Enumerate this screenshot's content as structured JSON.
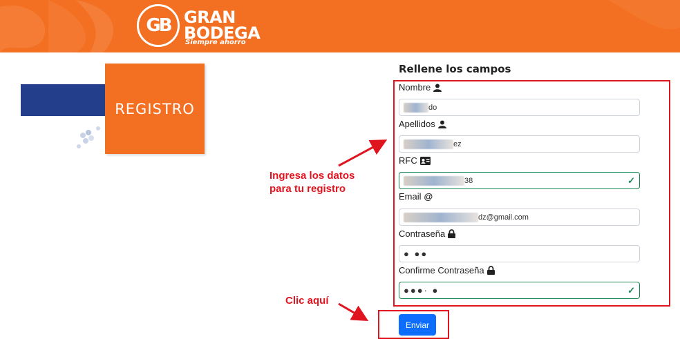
{
  "header": {
    "brand_line1": "GRAN",
    "brand_line2": "BODEGA",
    "tagline": "Siempre ahorro",
    "logo_mark": "GB"
  },
  "banner": {
    "title": "REGISTRO"
  },
  "form": {
    "title": "Rellene los campos",
    "fields": [
      {
        "label": "Nombre",
        "icon": "user-icon",
        "visible_value": "do",
        "valid": false
      },
      {
        "label": "Apellidos",
        "icon": "user-icon",
        "visible_value": "ez",
        "valid": false
      },
      {
        "label": "RFC",
        "icon": "id-card-icon",
        "visible_value": "38",
        "valid": true
      },
      {
        "label": "Email",
        "icon": "at-icon",
        "visible_value": "dz@gmail.com",
        "valid": false
      },
      {
        "label": "Contraseña",
        "icon": "lock-icon",
        "visible_value": "●                  ●●",
        "valid": false
      },
      {
        "label": "Confirme Contraseña",
        "icon": "lock-icon",
        "visible_value": "●●●·                  ●",
        "valid": true
      }
    ],
    "submit_label": "Enviar"
  },
  "annotations": {
    "fill_hint_line1": "Ingresa los datos",
    "fill_hint_line2": "para tu registro",
    "click_hint": "Clic aquí"
  },
  "colors": {
    "brand_orange": "#f36f21",
    "brand_blue": "#233e8b",
    "annotation_red": "#e0141e",
    "button_blue": "#0d6efd",
    "valid_green": "#198754"
  }
}
